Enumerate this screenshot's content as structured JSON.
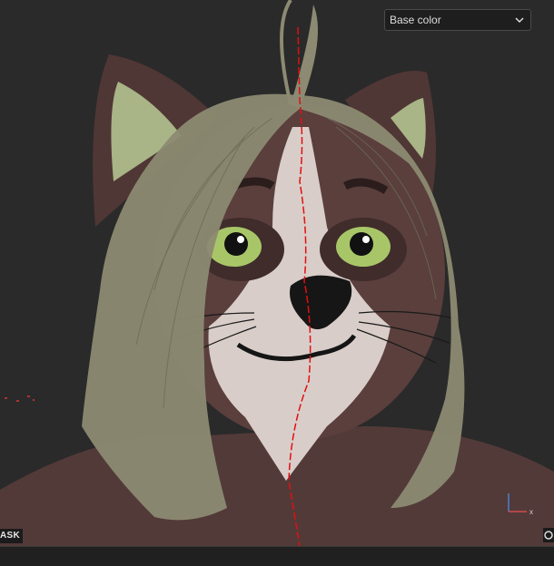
{
  "viewport": {
    "channel_select": {
      "value": "Base color"
    },
    "mask_label": "ASK",
    "gizmo": {
      "axis_x": "x"
    }
  },
  "colors": {
    "background": "#2a2a2a",
    "fur_dark": "#5a3f3d",
    "fur_light": "#d8cbc6",
    "hair": "#8c8a72",
    "eye": "#9cbd58",
    "seam_line": "#e01010"
  }
}
